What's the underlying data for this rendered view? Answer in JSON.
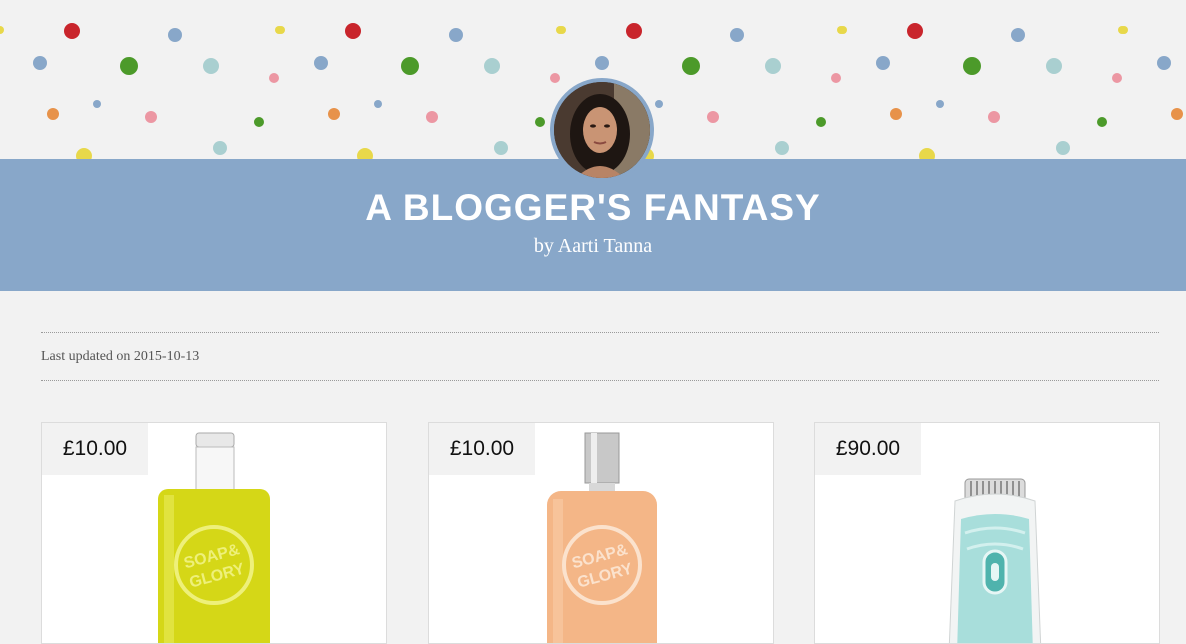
{
  "header": {
    "title": "A BLOGGER'S FANTASY",
    "byline": "by Aarti Tanna"
  },
  "meta": {
    "last_updated": "Last updated on 2015-10-13"
  },
  "products": [
    {
      "price": "£10.00",
      "image": "yellow-perfume-bottle"
    },
    {
      "price": "£10.00",
      "image": "peach-perfume-bottle"
    },
    {
      "price": "£90.00",
      "image": "epilator-device"
    }
  ],
  "colors": {
    "header_band": "#88a7c9",
    "background": "#f2f2f2",
    "card": "#ffffff"
  }
}
